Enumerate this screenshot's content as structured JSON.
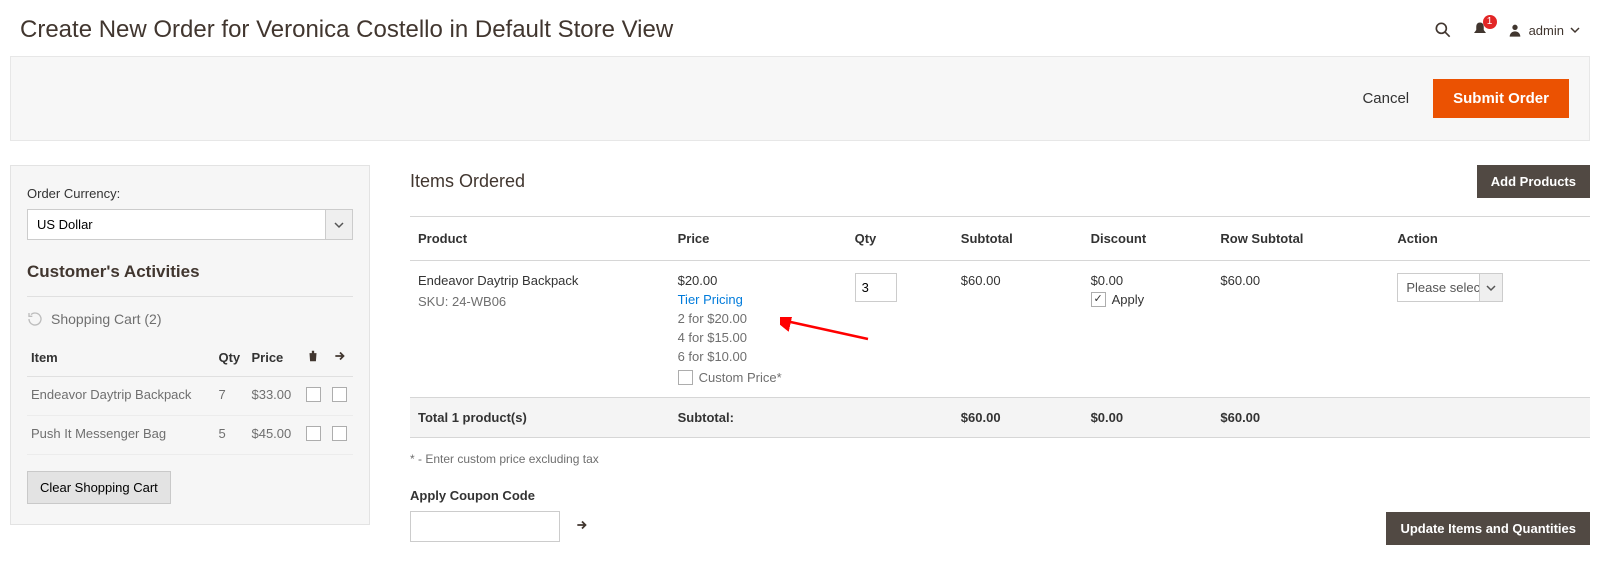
{
  "header": {
    "title": "Create New Order for Veronica Costello in Default Store View",
    "notifications_count": "1",
    "admin_label": "admin"
  },
  "actions": {
    "cancel": "Cancel",
    "submit": "Submit Order"
  },
  "sidebar": {
    "currency_label": "Order Currency:",
    "currency_value": "US Dollar",
    "activities_title": "Customer's Activities",
    "cart_title": "Shopping Cart (2)",
    "columns": {
      "item": "Item",
      "qty": "Qty",
      "price": "Price"
    },
    "cart_items": [
      {
        "name": "Endeavor Daytrip Backpack",
        "qty": "7",
        "price": "$33.00"
      },
      {
        "name": "Push It Messenger Bag",
        "qty": "5",
        "price": "$45.00"
      }
    ],
    "clear_cart": "Clear Shopping Cart"
  },
  "items": {
    "title": "Items Ordered",
    "add_products": "Add Products",
    "columns": {
      "product": "Product",
      "price": "Price",
      "qty": "Qty",
      "subtotal": "Subtotal",
      "discount": "Discount",
      "row_subtotal": "Row Subtotal",
      "action": "Action"
    },
    "row": {
      "name": "Endeavor Daytrip Backpack",
      "sku_label": "SKU:",
      "sku": "24-WB06",
      "price": "$20.00",
      "tier_link": "Tier Pricing",
      "tier1": "2 for $20.00",
      "tier2": "4 for $15.00",
      "tier3": "6 for $10.00",
      "custom_price_label": "Custom Price*",
      "qty": "3",
      "subtotal": "$60.00",
      "discount": "$0.00",
      "apply_label": "Apply",
      "row_subtotal": "$60.00",
      "action_placeholder": "Please select"
    },
    "totals": {
      "label": "Total 1 product(s)",
      "subtotal_label": "Subtotal:",
      "subtotal": "$60.00",
      "discount": "$0.00",
      "row_subtotal": "$60.00"
    },
    "footnote": "* - Enter custom price excluding tax",
    "coupon_label": "Apply Coupon Code",
    "update_btn": "Update Items and Quantities"
  }
}
